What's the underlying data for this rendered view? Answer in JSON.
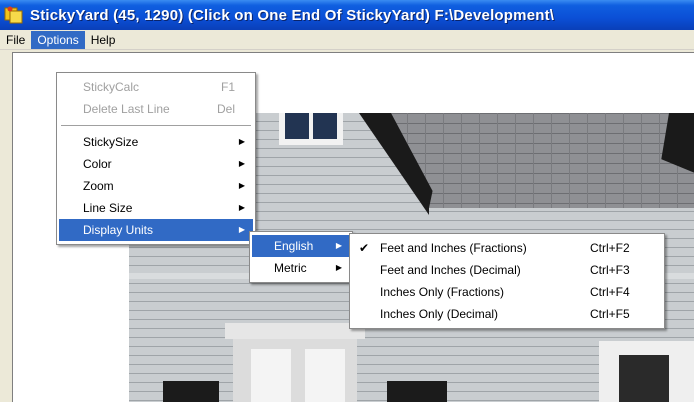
{
  "window": {
    "title": "StickyYard (45, 1290) (Click on One End Of StickyYard) F:\\Development\\"
  },
  "menubar": {
    "items": [
      {
        "label": "File"
      },
      {
        "label": "Options"
      },
      {
        "label": "Help"
      }
    ]
  },
  "options_menu": {
    "items": [
      {
        "label": "StickyCalc",
        "shortcut": "F1"
      },
      {
        "label": "Delete Last Line",
        "shortcut": "Del"
      },
      {
        "label": "StickySize"
      },
      {
        "label": "Color"
      },
      {
        "label": "Zoom"
      },
      {
        "label": "Line Size"
      },
      {
        "label": "Display Units"
      }
    ]
  },
  "units_menu": {
    "items": [
      {
        "label": "English"
      },
      {
        "label": "Metric"
      }
    ]
  },
  "english_menu": {
    "items": [
      {
        "label": "Feet and Inches (Fractions)",
        "shortcut": "Ctrl+F2"
      },
      {
        "label": "Feet and Inches (Decimal)",
        "shortcut": "Ctrl+F3"
      },
      {
        "label": "Inches Only (Fractions)",
        "shortcut": "Ctrl+F4"
      },
      {
        "label": "Inches Only (Decimal)",
        "shortcut": "Ctrl+F5"
      }
    ]
  },
  "icons": {
    "app": "sticky-note-app-icon",
    "submenu": "submenu-arrow-icon",
    "checked": "checkmark-icon"
  },
  "colors": {
    "titlebar": "#0b4fd6",
    "highlight": "#316ac5",
    "menu_bg": "#ffffff",
    "disabled_text": "#a0a0a0"
  }
}
